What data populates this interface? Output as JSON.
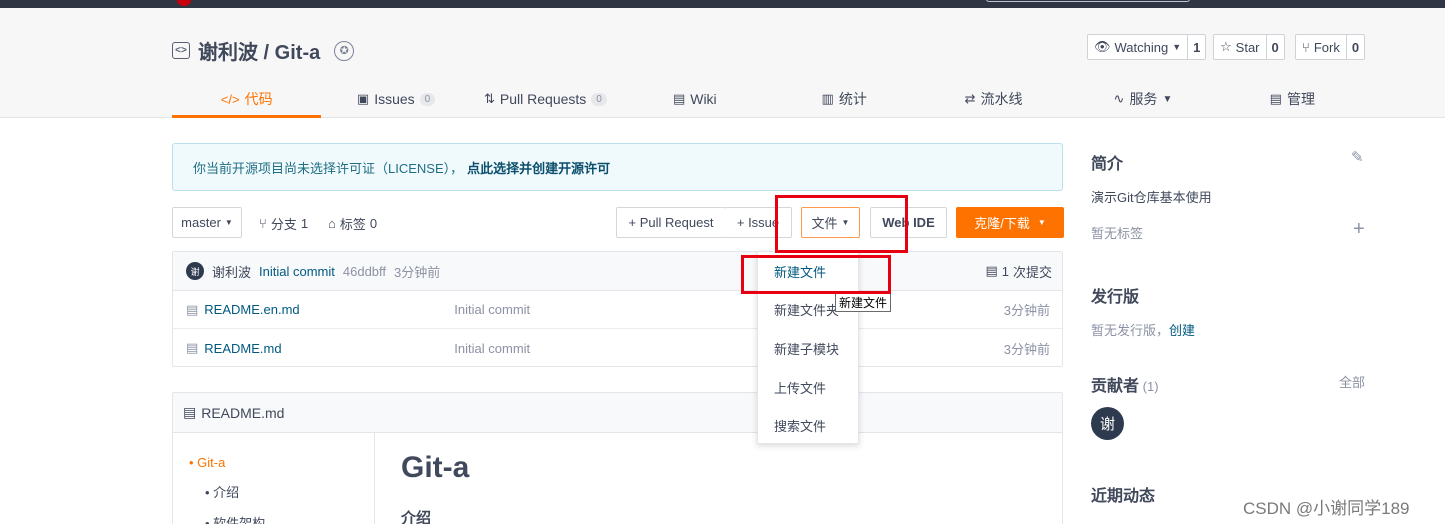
{
  "repo": {
    "title": "谢利波 / Git-a"
  },
  "social": {
    "watch_label": "Watching",
    "watch_count": "1",
    "star_label": "Star",
    "star_count": "0",
    "fork_label": "Fork",
    "fork_count": "0"
  },
  "tabs": [
    {
      "label": "代码",
      "icon": "code-icon"
    },
    {
      "label": "Issues",
      "count": "0",
      "icon": "issues-icon"
    },
    {
      "label": "Pull Requests",
      "count": "0",
      "icon": "pull-request-icon"
    },
    {
      "label": "Wiki",
      "icon": "wiki-icon"
    },
    {
      "label": "统计",
      "icon": "stats-icon"
    },
    {
      "label": "流水线",
      "icon": "pipeline-icon"
    },
    {
      "label": "服务",
      "icon": "service-icon"
    },
    {
      "label": "管理",
      "icon": "manage-icon"
    }
  ],
  "license": {
    "text": "你当前开源项目尚未选择许可证（LICENSE），",
    "link": "点此选择并创建开源许可"
  },
  "toolbar": {
    "branch": "master",
    "branches_label": "分支",
    "branches_count": "1",
    "tags_label": "标签",
    "tags_count": "0",
    "pull_request": "+ Pull Request",
    "issue": "+ Issue",
    "file": "文件",
    "web_ide": "Web IDE",
    "clone": "克隆/下载"
  },
  "commit": {
    "avatar": "谢",
    "author": "谢利波",
    "message": "Initial commit",
    "hash": "46ddbff",
    "time": "3分钟前",
    "commits_count": "1",
    "commits_label": "次提交"
  },
  "files": [
    {
      "name": "README.en.md",
      "message": "Initial commit",
      "time": "3分钟前"
    },
    {
      "name": "README.md",
      "message": "Initial commit",
      "time": "3分钟前"
    }
  ],
  "readme": {
    "title": "README.md",
    "toc": [
      "Git-a",
      "介绍",
      "软件架构"
    ],
    "h1": "Git-a",
    "h3": "介绍"
  },
  "sidebar": {
    "intro_title": "简介",
    "intro_desc": "演示Git仓库基本使用",
    "no_tags": "暂无标签",
    "release_title": "发行版",
    "no_release": "暂无发行版，",
    "create": "创建",
    "contributors_title": "贡献者",
    "contributors_count": "(1)",
    "all": "全部",
    "contributor_avatar": "谢",
    "activity_title": "近期动态"
  },
  "dropdown": {
    "items": [
      "新建文件",
      "新建文件夹",
      "新建子模块",
      "上传文件",
      "搜索文件"
    ]
  },
  "tooltip": "新建文件",
  "watermark": "CSDN @小谢同学189",
  "colors": {
    "accent": "#fe7300",
    "highlight": "#e60012",
    "link": "#005980"
  }
}
